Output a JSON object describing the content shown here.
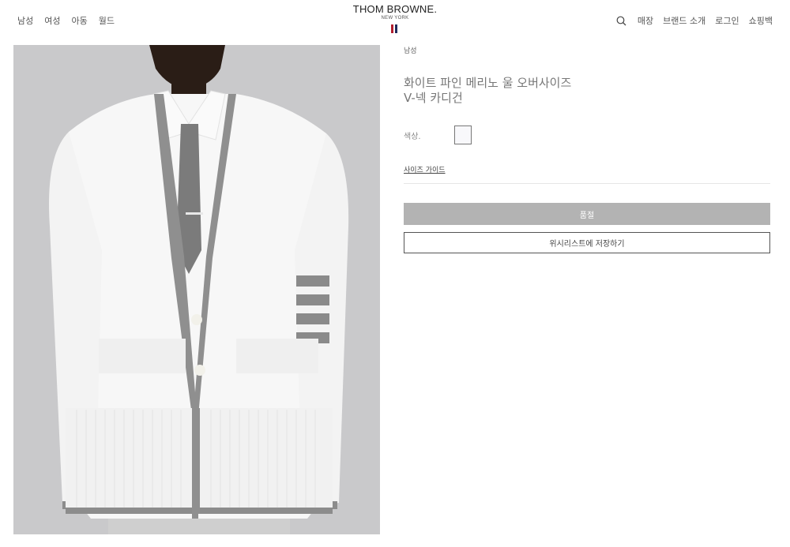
{
  "nav_left": [
    "남성",
    "여성",
    "아동",
    "월드"
  ],
  "logo": {
    "main": "THOM BROWNE.",
    "sub": "NEW YORK",
    "flag_colors": [
      "#b01e2e",
      "#ffffff",
      "#1f2a5b"
    ]
  },
  "nav_right": {
    "search_icon": "search-icon",
    "items": [
      "매장",
      "브랜드 소개",
      "로그인",
      "쇼핑백"
    ]
  },
  "product": {
    "image_alt": "white cardigan with grey stripes",
    "category": "남성",
    "title": "화이트 파인 메리노 울 오버사이즈 V-넥 카디건",
    "color_label": "색상.",
    "color_swatch": "#f8f8fb",
    "size_guide": "사이즈 가이드",
    "soldout_label": "품절",
    "wishlist_label": "위시리스트에 저장하기"
  },
  "colors": {
    "image_bg": "#c9c9cb",
    "button_disabled": "#b3b3b3"
  }
}
